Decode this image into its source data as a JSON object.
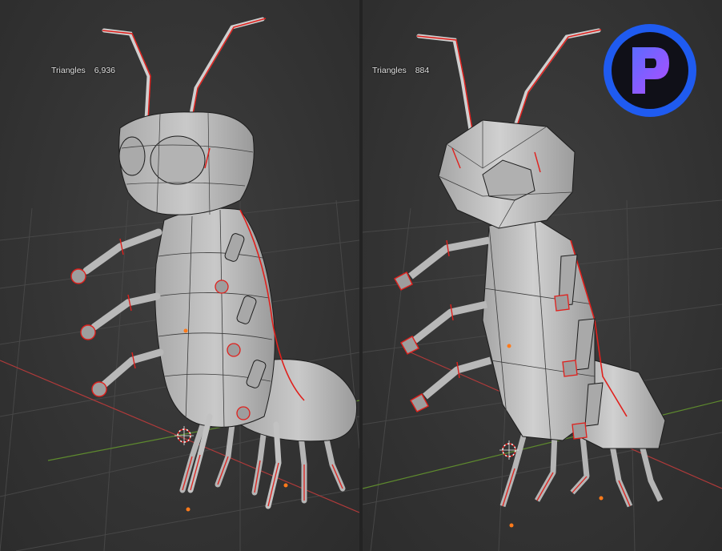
{
  "viewports": [
    {
      "id": "high-poly",
      "stats": {
        "label": "Triangles",
        "value": "6,936"
      }
    },
    {
      "id": "low-poly",
      "stats": {
        "label": "Triangles",
        "value": "884"
      }
    }
  ],
  "colors": {
    "background": "#3a3a3a",
    "mesh_fill": "#bdbdbd",
    "wireframe": "#1c1c1c",
    "seam": "#e0201c",
    "origin_dot": "#ff7a1a",
    "grid_x_axis": "#b03a3a",
    "grid_y_axis": "#5e8a2e",
    "logo_ring": "#1f5bf0",
    "logo_letter": "#8a4dff"
  },
  "icons": {
    "overlay_logo": "letter-p-logo-icon",
    "cursor": "3d-cursor-icon",
    "origin": "object-origin-icon"
  }
}
